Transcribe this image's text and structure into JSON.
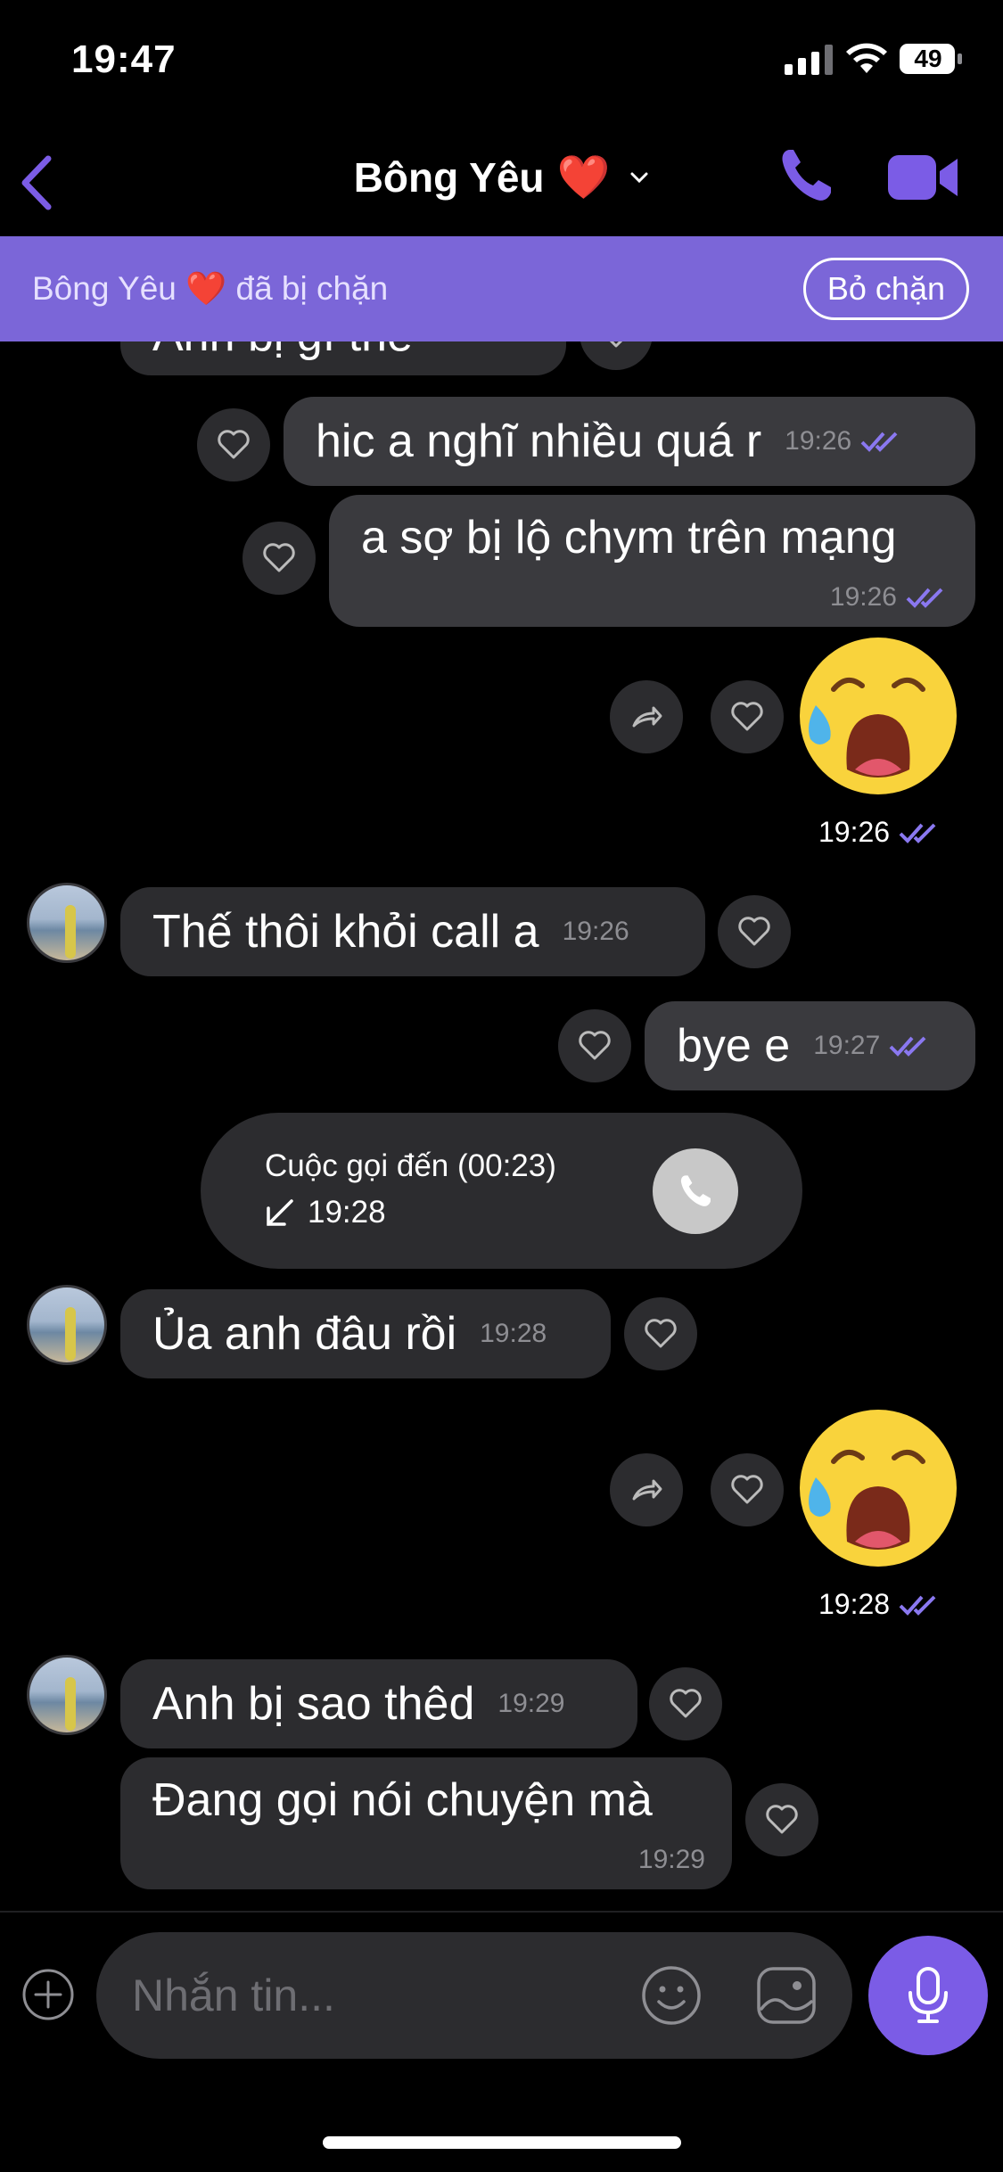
{
  "status_bar": {
    "time": "19:47",
    "battery": "49"
  },
  "header": {
    "contact_name": "Bông Yêu",
    "contact_emoji": "❤️",
    "icons": {
      "back": "chevron-left-icon",
      "dropdown": "chevron-down-icon",
      "call": "phone-icon",
      "video": "video-camera-icon"
    }
  },
  "banner": {
    "text": "Bông Yêu ❤️ đã bị chặn",
    "button_label": "Bỏ chặn"
  },
  "messages": {
    "cut_off_text": "Anh bị gì thế",
    "m1": {
      "text": "hic a nghĩ nhiều quá r",
      "time": "19:26"
    },
    "m2": {
      "text": "a sợ bị lộ chym trên mạng",
      "time": "19:26"
    },
    "sticker1": {
      "time": "19:26"
    },
    "m3": {
      "text": "Thế thôi khỏi call a",
      "time": "19:26"
    },
    "m4": {
      "text": "bye e",
      "time": "19:27"
    },
    "call": {
      "title": "Cuộc gọi đến (00:23)",
      "time": "19:28"
    },
    "m5": {
      "text": "Ủa anh đâu rồi",
      "time": "19:28"
    },
    "sticker2": {
      "time": "19:28"
    },
    "m6": {
      "text": "Anh bị sao thêd",
      "time": "19:29"
    },
    "m7": {
      "text": "Đang gọi nói chuyện mà",
      "time": "19:29"
    }
  },
  "composer": {
    "placeholder": "Nhắn tin..."
  },
  "colors": {
    "accent": "#7b5ce6",
    "banner": "#7b66d8",
    "bubble_out": "#3a3a3e",
    "bubble_in": "#2c2c2f",
    "tick": "#8a78f0"
  }
}
